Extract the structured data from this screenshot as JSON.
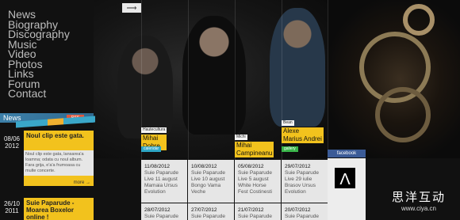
{
  "nav": {
    "items": [
      "News",
      "Biography",
      "Discography",
      "Music",
      "Video",
      "Photos",
      "Links",
      "Forum",
      "Contact"
    ]
  },
  "top_arrow": "⟶",
  "news": {
    "title": "News",
    "rss": "RSS",
    "items": [
      {
        "day": "08/06",
        "year": "2012",
        "headline": "Noul clip este gata.",
        "text": "Noul clip este gata, lansarea'a loamna; odata cu noul album. Fara grija, e'a'a frumoasa cu multe concerte.",
        "more": "more →"
      },
      {
        "day": "26/10",
        "year": "2011",
        "headline": "Suie Paparude - Moarea Boxelor online !",
        "text": "",
        "more": ""
      }
    ]
  },
  "members": [
    {
      "role": "Hautecultura",
      "name_line1": "Mihai",
      "name_line2": "Dobre"
    },
    {
      "role": "Michi",
      "name_line1": "Mihai",
      "name_line2": "Campineanu"
    },
    {
      "role": "Bean",
      "name_line1": "Alexe",
      "name_line2": "Marius Andrei"
    }
  ],
  "member_tags": {
    "calendar": "calendar",
    "gallery": "gallery"
  },
  "events": [
    {
      "date": "11/08/2012",
      "desc": "Suie Paparude Live 11 august Mamaia Ursus Evolution"
    },
    {
      "date": "10/08/2012",
      "desc": "Suie Paparude Live 10 august Bongo Vama Veche"
    },
    {
      "date": "05/08/2012",
      "desc": "Suie Paparude Live 5 august White Horse Fest Costinesti"
    },
    {
      "date": "29/07/2012",
      "desc": "Suie Paparude Live 29 iulie Brasov Ursus Evolution"
    },
    {
      "date": "28/07/2012",
      "desc": "Suie Paparude"
    },
    {
      "date": "27/07/2012",
      "desc": "Suie Paparude"
    },
    {
      "date": "21/07/2012",
      "desc": "Suie Paparude"
    },
    {
      "date": "20/07/2012",
      "desc": "Suie Paparude"
    }
  ],
  "facebook": {
    "label": "facebook",
    "logo": "Λ"
  },
  "watermark": {
    "cn": "思洋互动",
    "url": "www.ciya.cn"
  }
}
